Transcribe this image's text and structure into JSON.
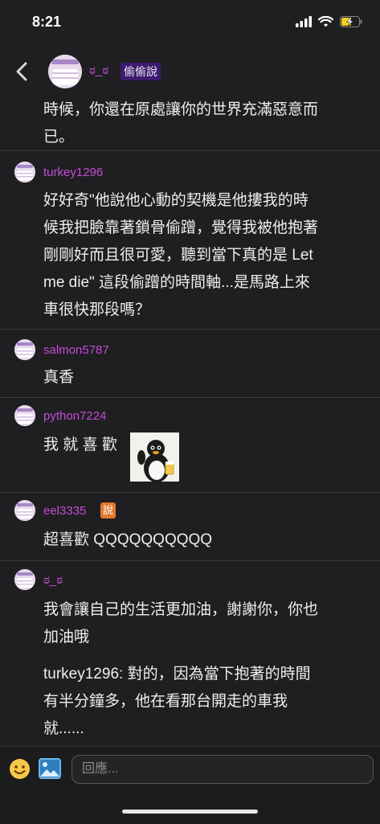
{
  "status_bar": {
    "time": "8:21"
  },
  "header": {
    "author": "ಠ_ಠ",
    "tag": "偷偷說"
  },
  "thread_text_lines": [
    "時候，你還在原處讓你的世界充滿惡意而",
    "已。"
  ],
  "comments": [
    {
      "author": "turkey1296",
      "lines": [
        "好好奇\"他說他心動的契機是他摟我的時",
        "候我把臉靠著鎖骨偷蹭，覺得我被他抱著",
        "剛剛好而且很可愛，聽到當下真的是 Let",
        "me die\" 這段偷蹭的時間軸...是馬路上來",
        "車很快那段嗎？"
      ]
    },
    {
      "author": "salmon5787",
      "lines": [
        "真香"
      ]
    },
    {
      "author": "python7224",
      "lines": [
        "我 就 喜 歡"
      ]
    },
    {
      "author": "eel3335",
      "badge": "說",
      "lines": [
        "超喜歡 QQQQQQQQQQ"
      ]
    },
    {
      "author": "ಠ_ಠ",
      "lines": [
        "我會讓自己的生活更加油，謝謝你，你也",
        "加油哦"
      ],
      "quote_lines": [
        "turkey1296: 對的，因為當下抱著的時間",
        "有半分鐘多，他在看那台開走的車我",
        "就......"
      ]
    }
  ],
  "reply": {
    "placeholder": "回應..."
  },
  "icons": {
    "back": "chevron-left-icon",
    "emoji": "emoji-icon",
    "image": "image-icon",
    "signal": "signal-icon",
    "wifi": "wifi-icon",
    "battery": "battery-charging-icon"
  },
  "colors": {
    "author": "#c34cd8",
    "background": "#1f1f21",
    "tag": "#3e1b71",
    "badge": "#e07a2e",
    "battery": "#f7d21b"
  }
}
